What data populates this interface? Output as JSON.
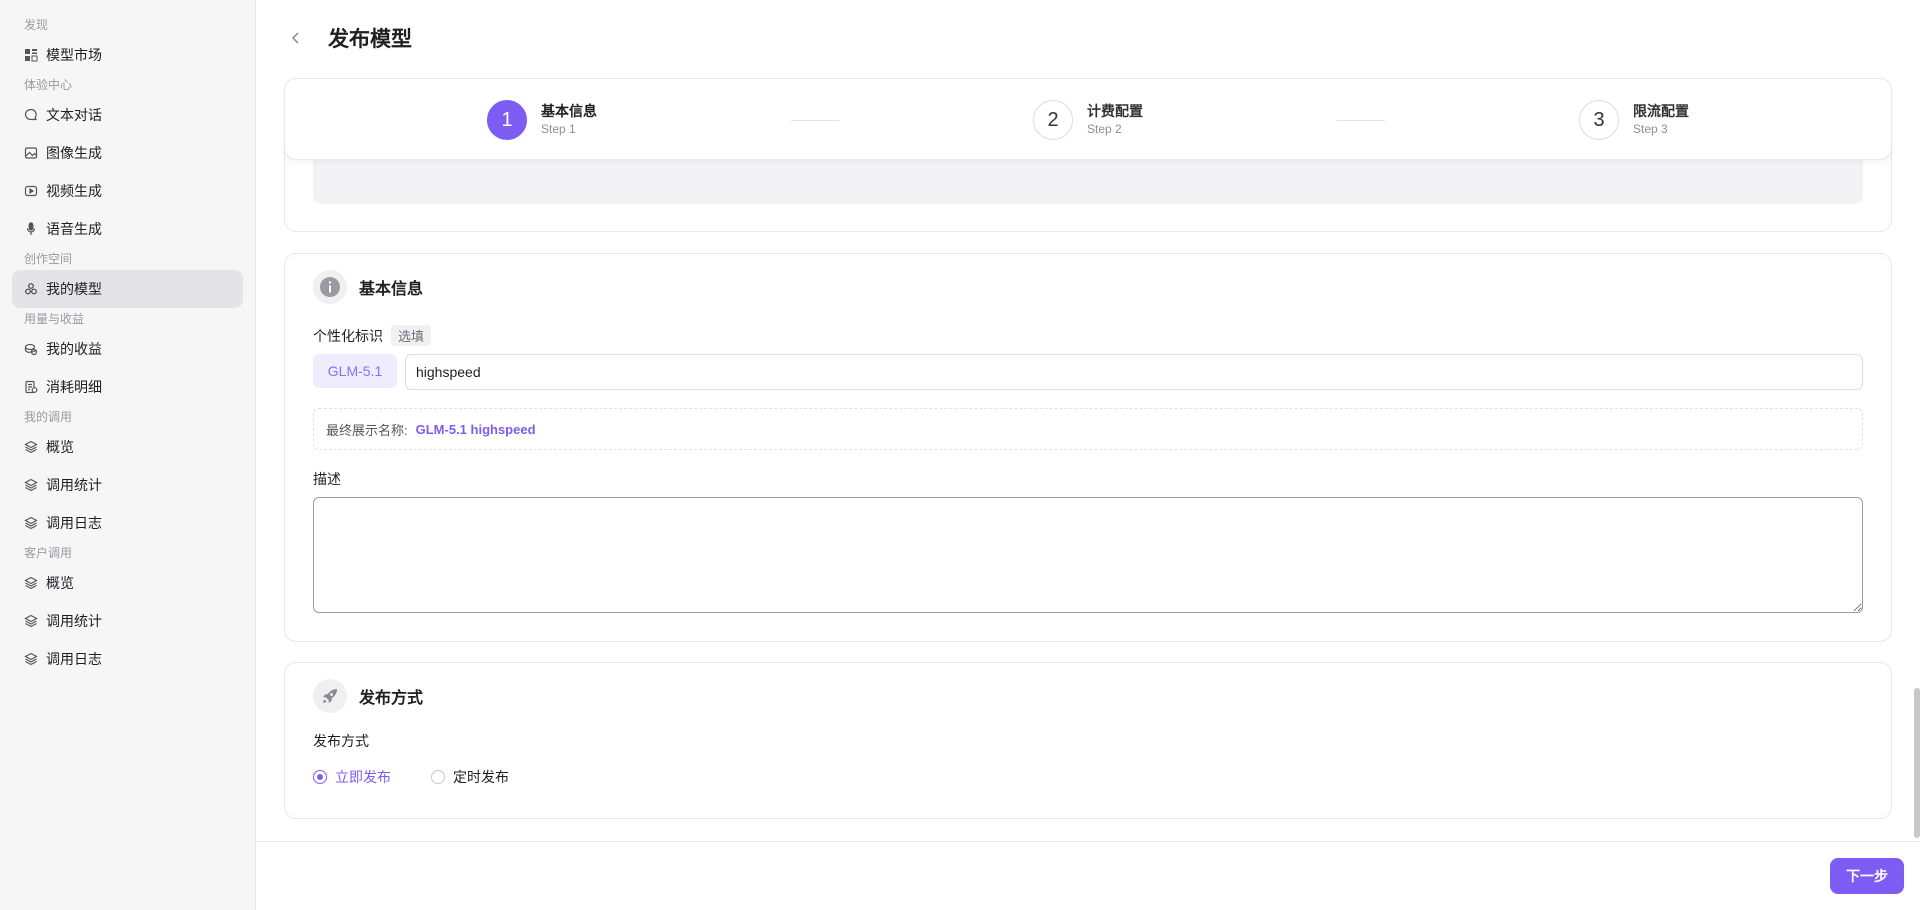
{
  "sidebar": {
    "groups": [
      {
        "title": "发现",
        "items": [
          {
            "label": "模型市场",
            "icon": "grid-icon"
          }
        ]
      },
      {
        "title": "体验中心",
        "items": [
          {
            "label": "文本对话",
            "icon": "chat-bubble-icon"
          },
          {
            "label": "图像生成",
            "icon": "image-icon"
          },
          {
            "label": "视频生成",
            "icon": "video-icon"
          },
          {
            "label": "语音生成",
            "icon": "microphone-icon"
          }
        ]
      },
      {
        "title": "创作空间",
        "items": [
          {
            "label": "我的模型",
            "icon": "models-icon",
            "active": true
          }
        ]
      },
      {
        "title": "用量与收益",
        "items": [
          {
            "label": "我的收益",
            "icon": "coins-icon"
          },
          {
            "label": "消耗明细",
            "icon": "receipt-icon"
          }
        ]
      },
      {
        "title": "我的调用",
        "items": [
          {
            "label": "概览",
            "icon": "layers-icon"
          },
          {
            "label": "调用统计",
            "icon": "layers-icon"
          },
          {
            "label": "调用日志",
            "icon": "layers-icon"
          }
        ]
      },
      {
        "title": "客户调用",
        "items": [
          {
            "label": "概览",
            "icon": "layers-icon"
          },
          {
            "label": "调用统计",
            "icon": "layers-icon"
          },
          {
            "label": "调用日志",
            "icon": "layers-icon"
          }
        ]
      }
    ]
  },
  "header": {
    "title": "发布模型"
  },
  "steps": [
    {
      "number": "1",
      "title": "基本信息",
      "sub": "Step 1",
      "active": true
    },
    {
      "number": "2",
      "title": "计费配置",
      "sub": "Step 2",
      "active": false
    },
    {
      "number": "3",
      "title": "限流配置",
      "sub": "Step 3",
      "active": false
    }
  ],
  "basic_info": {
    "title": "基本信息",
    "custom_id_label": "个性化标识",
    "optional_tag": "选填",
    "prefix": "GLM-5.1",
    "custom_id_value": "highspeed",
    "preview_label": "最终展示名称:",
    "preview_value": "GLM-5.1 highspeed",
    "description_label": "描述",
    "description_value": ""
  },
  "publish": {
    "title": "发布方式",
    "method_label": "发布方式",
    "options": [
      {
        "label": "立即发布",
        "checked": true
      },
      {
        "label": "定时发布",
        "checked": false
      }
    ]
  },
  "footer": {
    "next_label": "下一步"
  },
  "colors": {
    "accent": "#7c5cf3",
    "accent_light": "#efecfd"
  }
}
